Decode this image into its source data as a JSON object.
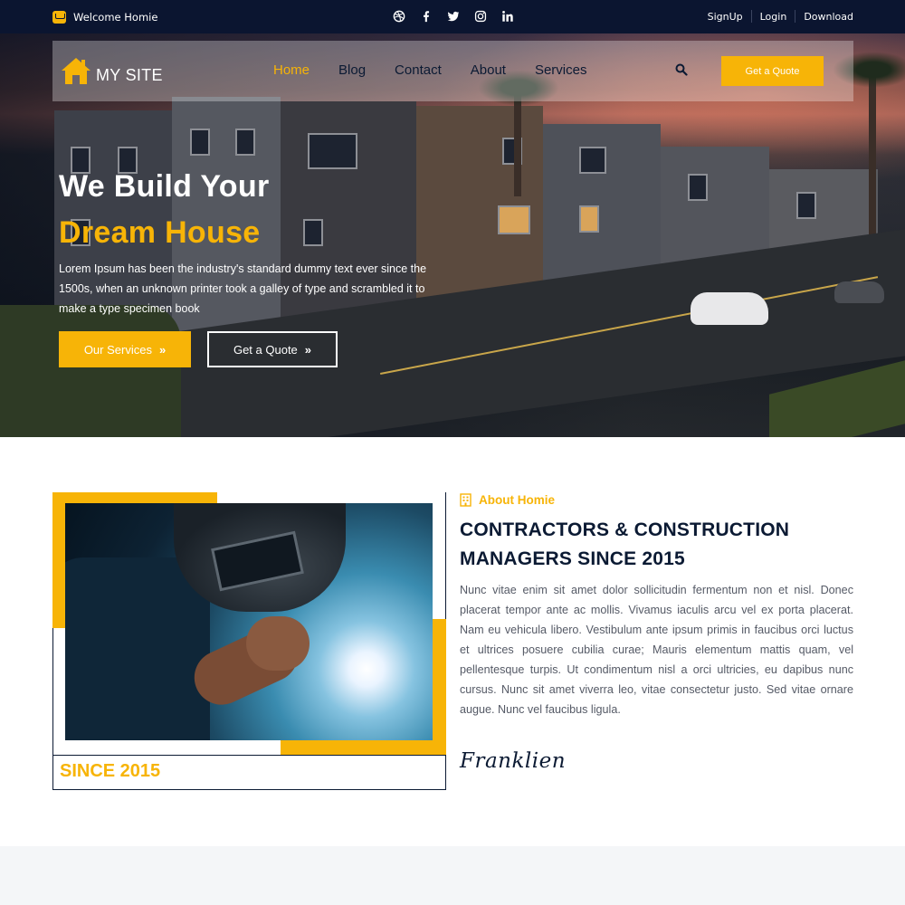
{
  "topbar": {
    "welcome": "Welcome Homie",
    "envelope_icon": "envelope-icon",
    "socials": [
      "dribbble-icon",
      "facebook-icon",
      "twitter-icon",
      "instagram-icon",
      "linkedin-icon"
    ],
    "links": [
      "SignUp",
      "Login",
      "Download"
    ]
  },
  "nav": {
    "logo_text": "MY SITE",
    "logo_icon": "house-icon",
    "items": [
      "Home",
      "Blog",
      "Contact",
      "About",
      "Services"
    ],
    "active": "Home",
    "search_icon": "search-icon",
    "cta": "Get a Quote"
  },
  "hero": {
    "title_line1": "We Build Your",
    "title_line2": "Dream House",
    "description": "Lorem Ipsum has been the industry's standard dummy text ever since the 1500s, when an unknown printer took a galley of type and scrambled it to make a type specimen book",
    "btn_primary": "Our Services",
    "btn_secondary": "Get a Quote"
  },
  "about": {
    "label": "About Homie",
    "heading": "CONTRACTORS & CONSTRUCTION MANAGERS SINCE 2015",
    "body": "Nunc vitae enim sit amet dolor sollicitudin fermentum non et nisl. Donec placerat tempor ante ac mollis. Vivamus iaculis arcu vel ex porta placerat. Nam eu vehicula libero. Vestibulum ante ipsum primis in faucibus orci luctus et ultrices posuere cubilia curae; Mauris elementum mattis quam, vel pellentesque turpis. Ut condimentum nisl a orci ultricies, eu dapibus nunc cursus. Nunc sit amet viverra leo, vitae consectetur justo. Sed vitae ornare augue. Nunc vel faucibus ligula.",
    "signature": "Franklien",
    "since": "SINCE 2015"
  },
  "colors": {
    "accent": "#f7b407",
    "dark": "#0b1530",
    "heading": "#0b1a33"
  }
}
